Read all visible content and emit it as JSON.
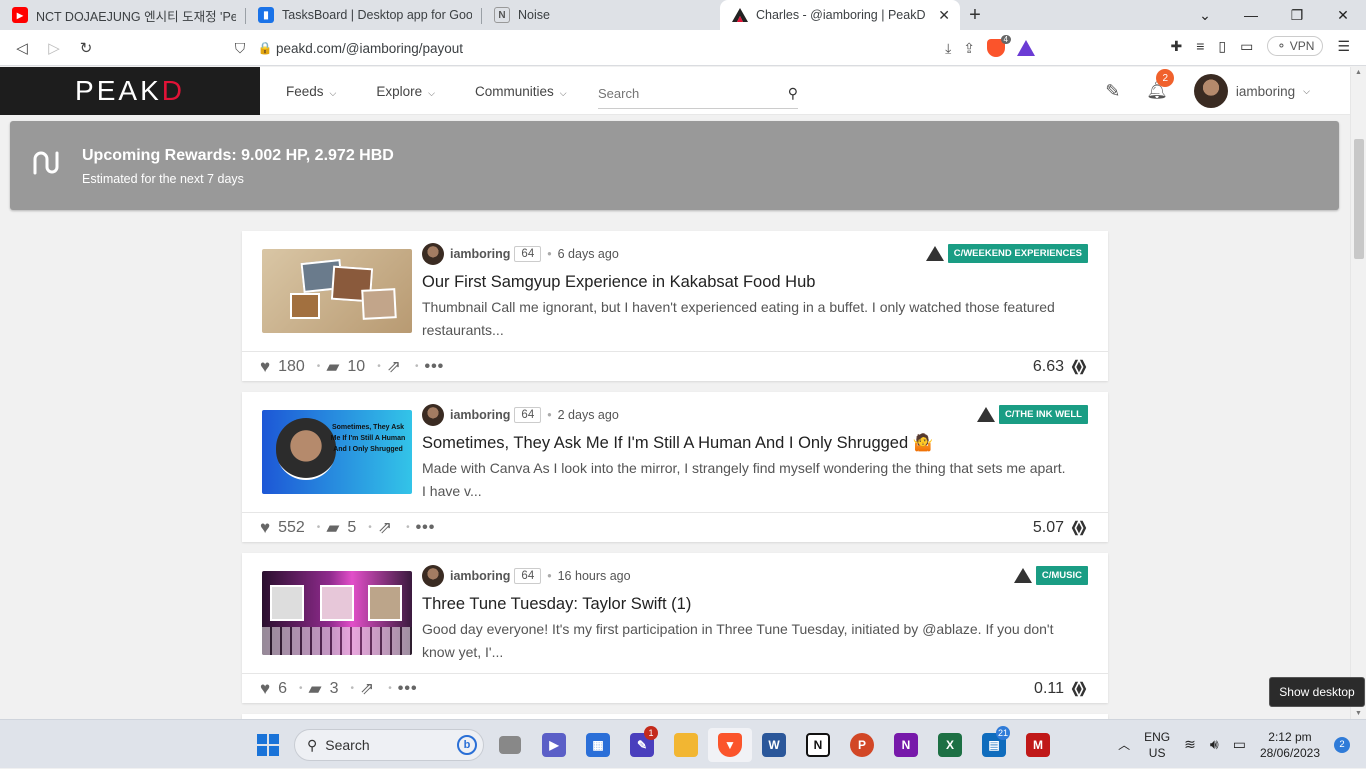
{
  "browser": {
    "tabs": [
      {
        "title": "NCT DOJAEJUNG 엔시티 도재정 'Perfu",
        "icon": "youtube-icon",
        "icon_color": "#ff0000"
      },
      {
        "title": "TasksBoard | Desktop app for Google",
        "icon": "tasksboard-icon",
        "icon_color": "#1a73e8"
      },
      {
        "title": "Noise",
        "icon": "notion-icon",
        "icon_color": "#555555"
      },
      {
        "title": "Charles - @iamboring | PeakD",
        "icon": "peakd-icon",
        "icon_color": "#e31337"
      }
    ],
    "new_tab": "+",
    "url": "peakd.com/@iamboring/payout",
    "vpn_label": "VPN",
    "shield_count": "4"
  },
  "site": {
    "logo": {
      "part1": "PE",
      "part2": "A",
      "part3": "K",
      "part4": "D"
    },
    "menu": [
      {
        "label": "Feeds"
      },
      {
        "label": "Explore"
      },
      {
        "label": "Communities"
      }
    ],
    "search_placeholder": "Search",
    "notification_count": "2",
    "username": "iamboring"
  },
  "rewards": {
    "title": "Upcoming Rewards: 9.002 HP, 2.972 HBD",
    "subtitle": "Estimated for the next 7 days"
  },
  "posts": [
    {
      "author": "iamboring",
      "reputation": "64",
      "time": "6 days ago",
      "community": "C/WEEKEND EXPERIENCES",
      "title": "Our First Samgyup Experience in Kakabsat Food Hub",
      "description": "Thumbnail Call me ignorant, but I haven't experienced eating in a buffet. I only watched those featured restaurants...",
      "votes": "180",
      "comments": "10",
      "payout": "6.63"
    },
    {
      "author": "iamboring",
      "reputation": "64",
      "time": "2 days ago",
      "community": "C/THE INK WELL",
      "title": "Sometimes, They Ask Me If I'm Still A Human And I Only Shrugged 🤷",
      "description": "Made with Canva As I look into the mirror, I strangely find myself wondering the thing that sets me apart. I have v...",
      "thumb_text": "Sometimes, They Ask Me If I'm Still A Human And I Only Shrugged",
      "votes": "552",
      "comments": "5",
      "payout": "5.07"
    },
    {
      "author": "iamboring",
      "reputation": "64",
      "time": "16 hours ago",
      "community": "C/MUSIC",
      "title": "Three Tune Tuesday: Taylor Swift (1)",
      "description": "Good day everyone! It's my first participation in Three Tune Tuesday, initiated by @ablaze. If you don't know yet, I'...",
      "votes": "6",
      "comments": "3",
      "payout": "0.11"
    }
  ],
  "taskbar": {
    "search_label": "Search",
    "lang_line1": "ENG",
    "lang_line2": "US",
    "time": "2:12 pm",
    "date": "28/06/2023",
    "notification_count": "2",
    "badge_app": "1",
    "badge_outlook": "21",
    "tooltip": "Show desktop"
  },
  "colors": {
    "accent_red": "#e31337",
    "community_tag": "#1a9d84",
    "rewards_bg": "#999999",
    "notif_orange": "#f0612c"
  }
}
